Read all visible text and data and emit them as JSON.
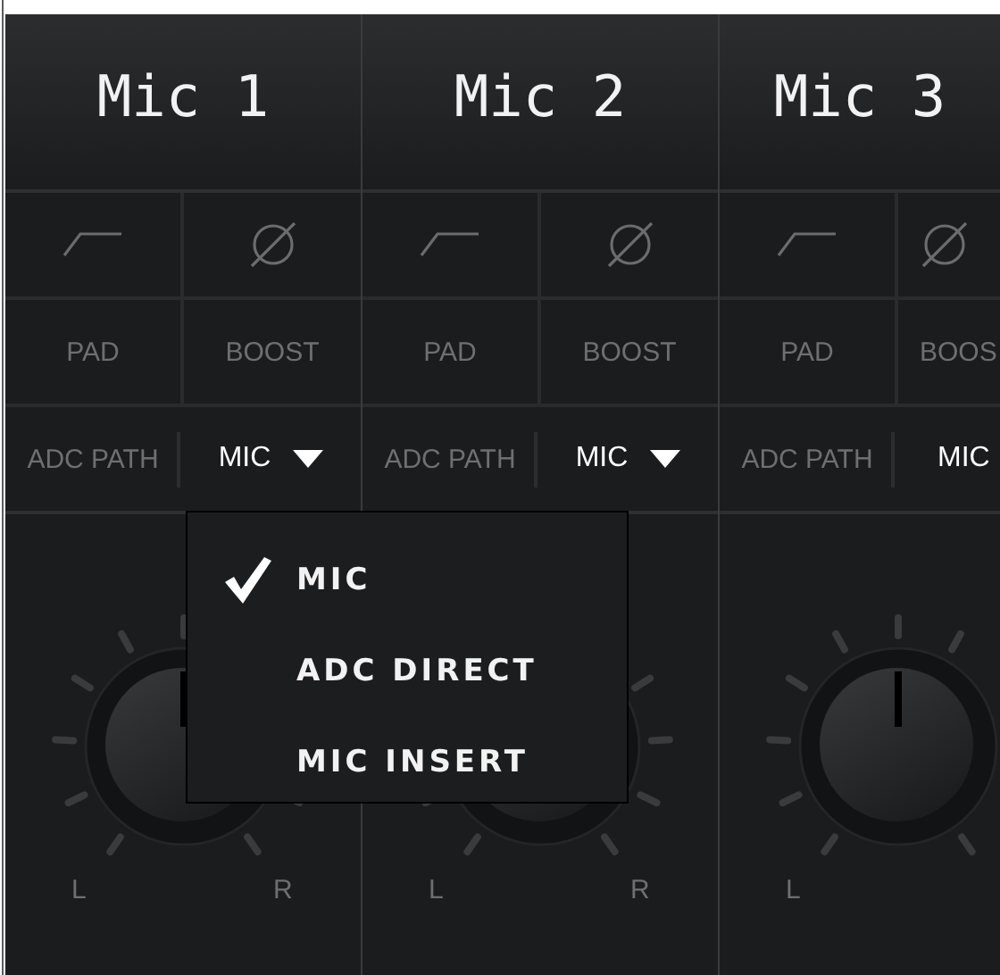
{
  "channels": [
    {
      "name": "Mic 1",
      "icon_buttons": [
        {
          "kind": "highpass"
        },
        {
          "kind": "phase"
        }
      ],
      "toggles": [
        "PAD",
        "BOOST"
      ],
      "adc_path": {
        "label": "ADC PATH",
        "value": "MIC",
        "caret": true
      },
      "pan": {
        "left": "L",
        "right": "R"
      }
    },
    {
      "name": "Mic 2",
      "icon_buttons": [
        {
          "kind": "highpass"
        },
        {
          "kind": "phase"
        }
      ],
      "toggles": [
        "PAD",
        "BOOST"
      ],
      "adc_path": {
        "label": "ADC PATH",
        "value": "MIC",
        "caret": true
      },
      "pan": {
        "left": "L",
        "right": "R"
      }
    },
    {
      "name": "Mic 3",
      "icon_buttons": [
        {
          "kind": "highpass"
        },
        {
          "kind": "phase"
        }
      ],
      "toggles": [
        "PAD",
        "BOOS"
      ],
      "adc_path": {
        "label": "ADC PATH",
        "value": "MIC",
        "caret": false
      },
      "pan": {
        "left": "L"
      }
    }
  ],
  "dropdown_menu": {
    "items": [
      {
        "label": "MIC",
        "selected": true
      },
      {
        "label": "ADC DIRECT",
        "selected": false
      },
      {
        "label": "MIC INSERT",
        "selected": false
      }
    ]
  }
}
